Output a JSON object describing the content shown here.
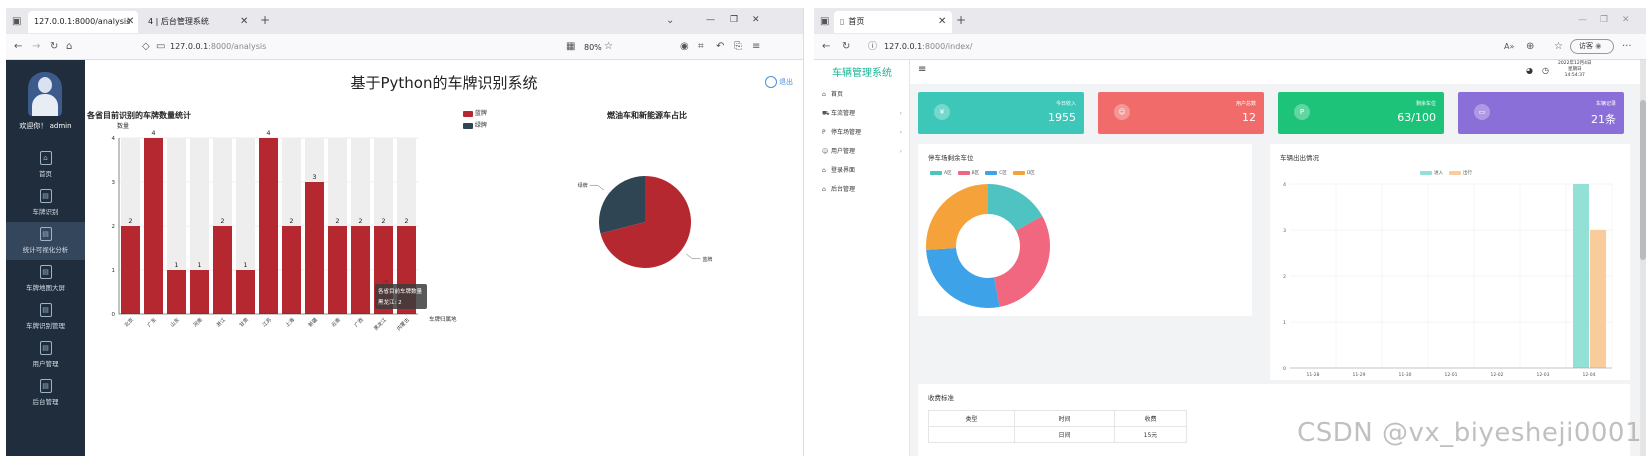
{
  "left_window": {
    "tabs": [
      {
        "label": "127.0.0.1:8000/analysis"
      },
      {
        "label": "4 | 后台管理系统"
      }
    ],
    "url": {
      "host": "127.0.0.1",
      "path": ":8000/analysis"
    },
    "zoom": "80%",
    "sidebar": {
      "welcome": "欢迎你！ admin",
      "items": [
        {
          "label": "首页"
        },
        {
          "label": "车牌识别"
        },
        {
          "label": "统计可视化分析"
        },
        {
          "label": "车牌地图大屏"
        },
        {
          "label": "车牌识别管理"
        },
        {
          "label": "用户管理"
        },
        {
          "label": "后台管理"
        }
      ]
    },
    "system_title": "基于Python的车牌识别系统",
    "logout_label": "退出",
    "tooltip": {
      "title": "各省目前车牌数量",
      "line": "黑龙江: 2"
    }
  },
  "chart_data": [
    {
      "type": "bar",
      "title": "各省目前识别的车牌数量统计",
      "ylabel": "数量",
      "xlabel": "车牌归属地",
      "legend": [
        {
          "name": "蓝牌",
          "color": "#b52830"
        },
        {
          "name": "绿牌",
          "color": "#2f4554"
        }
      ],
      "categories": [
        "北京",
        "广东",
        "山东",
        "河南",
        "浙江",
        "甘肃",
        "江苏",
        "上海",
        "新疆",
        "云南",
        "广西",
        "黑龙江",
        "内蒙古"
      ],
      "values": [
        2,
        4,
        1,
        1,
        2,
        1,
        4,
        2,
        3,
        2,
        2,
        2,
        2
      ],
      "ylim": [
        0,
        4
      ],
      "yticks": [
        "0",
        "1",
        "2",
        "3",
        "4"
      ],
      "legend_position": "top-right",
      "color": "#b52830"
    },
    {
      "type": "pie",
      "title": "燃油车和新能源车占比",
      "slices": [
        {
          "name": "蓝牌",
          "value": 71,
          "color": "#b52830"
        },
        {
          "name": "绿牌",
          "value": 29,
          "color": "#2f4554"
        }
      ]
    },
    {
      "type": "pie",
      "title": "停车场剩余车位",
      "legend": [
        {
          "name": "A区",
          "color": "#4fc3c1"
        },
        {
          "name": "B区",
          "color": "#f0677f"
        },
        {
          "name": "C区",
          "color": "#3ea2e8"
        },
        {
          "name": "D区",
          "color": "#f6a23a"
        }
      ],
      "slices": [
        {
          "name": "A区",
          "value": 17,
          "color": "#4fc3c1"
        },
        {
          "name": "B区",
          "value": 30,
          "color": "#f0677f"
        },
        {
          "name": "C区",
          "value": 27,
          "color": "#3ea2e8"
        },
        {
          "name": "D区",
          "value": 26,
          "color": "#f6a23a"
        }
      ]
    },
    {
      "type": "bar",
      "title": "车辆出出情况",
      "legend": [
        {
          "name": "进入",
          "color": "#93e0d6"
        },
        {
          "name": "出行",
          "color": "#f8cd9b"
        }
      ],
      "categories": [
        "11-28",
        "11-29",
        "11-30",
        "12-01",
        "12-02",
        "12-03",
        "12-04"
      ],
      "series": [
        {
          "name": "进入",
          "values": [
            0,
            0,
            0,
            0,
            0,
            0,
            4
          ],
          "color": "#93e0d6"
        },
        {
          "name": "出行",
          "values": [
            0,
            0,
            0,
            0,
            0,
            0,
            3
          ],
          "color": "#f8cd9b"
        }
      ],
      "ylim": [
        0,
        4
      ],
      "yticks": [
        "0",
        "1",
        "2",
        "3",
        "4"
      ],
      "legend_position": "top-center"
    }
  ],
  "right_window": {
    "tab_label": "首页",
    "url": {
      "host": "127.0.0.1",
      "path": ":8000/index/"
    },
    "guest_label": "访客",
    "brand": "车辆管理系统",
    "date_text": "2022年12月4日",
    "weekday_text": "星期日",
    "time_text": "14:54:37",
    "sidebar": [
      {
        "label": "首页",
        "icon": "home-icon",
        "chevron": false
      },
      {
        "label": "车流管理",
        "icon": "car-icon",
        "chevron": true
      },
      {
        "label": "停车场管理",
        "icon": "parking-icon",
        "chevron": true
      },
      {
        "label": "用户管理",
        "icon": "user-icon",
        "chevron": true
      },
      {
        "label": "登录界面",
        "icon": "home-icon",
        "chevron": false
      },
      {
        "label": "后台管理",
        "icon": "home-icon",
        "chevron": false
      }
    ],
    "cards": [
      {
        "label": "今日收入",
        "value": "1955",
        "color": "#3cc7b8",
        "icon": "yen-icon"
      },
      {
        "label": "用户总数",
        "value": "12",
        "color": "#f26b6b",
        "icon": "user-icon"
      },
      {
        "label": "剩余车位",
        "value": "63/100",
        "color": "#1ec37a",
        "icon": "parking-icon"
      },
      {
        "label": "车辆记录",
        "value": "21条",
        "color": "#8b6fd8",
        "icon": "monitor-icon"
      }
    ],
    "fees": {
      "title": "收费标准",
      "headers": [
        "类型",
        "时间",
        "收费"
      ],
      "row": [
        "",
        "日间",
        "15元"
      ]
    },
    "watermark": "CSDN @vx_biyesheji0001"
  }
}
